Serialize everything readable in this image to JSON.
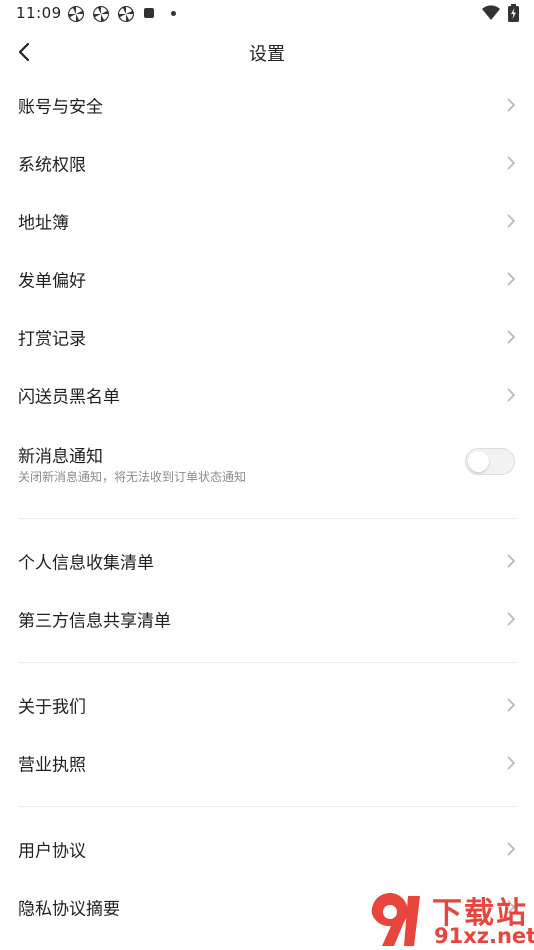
{
  "status_bar": {
    "time": "11:09",
    "icons": [
      "pinwheel-icon",
      "pinwheel-icon",
      "pinwheel-icon",
      "stop-icon",
      "dot-icon",
      "wifi-icon",
      "battery-charging-icon"
    ]
  },
  "nav": {
    "title": "设置",
    "back_icon": "chevron-left-icon"
  },
  "settings": {
    "group1": [
      {
        "label": "账号与安全"
      },
      {
        "label": "系统权限"
      },
      {
        "label": "地址簿"
      },
      {
        "label": "发单偏好"
      },
      {
        "label": "打赏记录"
      },
      {
        "label": "闪送员黑名单"
      }
    ],
    "notification": {
      "label": "新消息通知",
      "sub": "关闭新消息通知，将无法收到订单状态通知",
      "enabled": false
    },
    "group2": [
      {
        "label": "个人信息收集清单"
      },
      {
        "label": "第三方信息共享清单"
      }
    ],
    "group3": [
      {
        "label": "关于我们"
      },
      {
        "label": "营业执照"
      }
    ],
    "group4": [
      {
        "label": "用户协议"
      },
      {
        "label": "隐私协议摘要"
      }
    ]
  },
  "watermark": {
    "top": "下载站",
    "bottom": "91xz.net",
    "color": "#e8463c"
  }
}
